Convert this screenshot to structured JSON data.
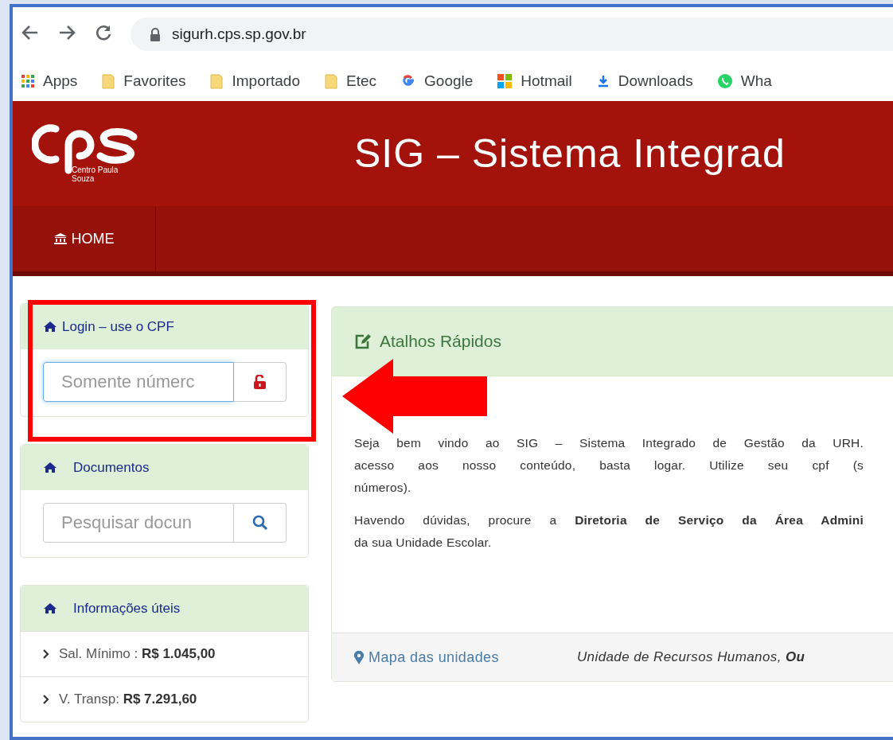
{
  "browser": {
    "url": "sigurh.cps.sp.gov.br",
    "bookmarks": [
      {
        "label": "Apps",
        "kind": "apps"
      },
      {
        "label": "Favorites",
        "kind": "folder"
      },
      {
        "label": "Importado",
        "kind": "folder"
      },
      {
        "label": "Etec",
        "kind": "folder"
      },
      {
        "label": "Google",
        "kind": "google"
      },
      {
        "label": "Hotmail",
        "kind": "tiles"
      },
      {
        "label": "Downloads",
        "kind": "download"
      },
      {
        "label": "Wha",
        "kind": "chat"
      }
    ]
  },
  "header": {
    "logo_text": "Centro Paula Souza",
    "title": "SIG – Sistema Integrad"
  },
  "nav": [
    {
      "label": "HOME"
    }
  ],
  "login": {
    "title": "Login – use o CPF",
    "placeholder": "Somente númerc"
  },
  "documents": {
    "title": "Documentos",
    "placeholder": "Pesquisar docun"
  },
  "info": {
    "title": "Informações úteis",
    "items": [
      {
        "label": "Sal. Mínimo :",
        "value": "R$ 1.045,00"
      },
      {
        "label": "V. Transp:",
        "value": "R$ 7.291,60"
      }
    ]
  },
  "shortcuts": {
    "title": "Atalhos Rápidos",
    "paragraphs": [
      [
        "Seja bem vindo ao SIG – Sistema Integrado de Gestão da URH.",
        "acesso aos nosso conteúdo, basta logar. Utilize seu cpf (s",
        "números)."
      ],
      [
        "Havendo dúvidas, procure a **Diretoria de Serviço da Área Admini**",
        "da sua Unidade Escolar."
      ]
    ],
    "map_link": "Mapa das unidades",
    "footer_text": "Unidade de Recursos Humanos, **Ou**"
  }
}
